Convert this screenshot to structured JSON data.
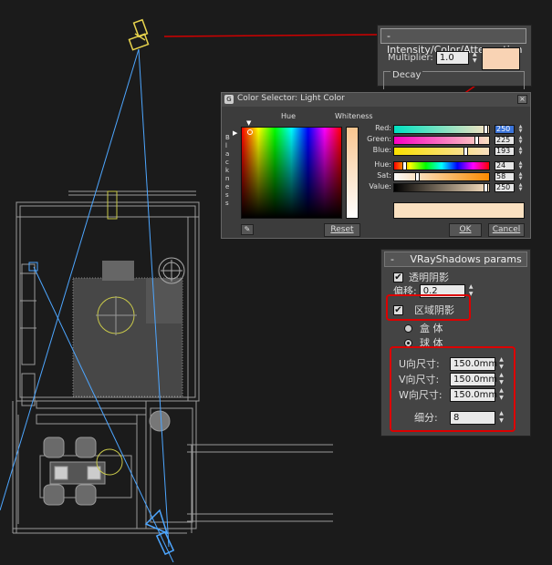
{
  "atten_panel": {
    "title": "Intensity/Color/Attenuation",
    "multiplier_label": "Multiplier:",
    "multiplier_value": "1.0",
    "swatch_color": "#f9d3b4",
    "decay_label": "Decay"
  },
  "color_selector": {
    "title": "Color Selector: Light Color",
    "hue_header": "Hue",
    "whiteness_header": "Whiteness",
    "blackness_label": "B l a c k n e s s",
    "channels": [
      {
        "label": "Red:",
        "value": "250",
        "level": 0.98
      },
      {
        "label": "Green:",
        "value": "225",
        "level": 0.88
      },
      {
        "label": "Blue:",
        "value": "193",
        "level": 0.76
      },
      {
        "label": "Hue:",
        "value": "24",
        "level": 0.09
      },
      {
        "label": "Sat:",
        "value": "58",
        "level": 0.23
      },
      {
        "label": "Value:",
        "value": "250",
        "level": 0.98
      }
    ],
    "preview_color": "#fae1c1",
    "reset_label": "Reset",
    "ok_label": "OK",
    "cancel_label": "Cancel"
  },
  "vray_shadows": {
    "title": "VRayShadows params",
    "transparent_shadows": "透明阴影",
    "transparent_checked": "✔",
    "bias_label": "偏移:",
    "bias_value": "0.2",
    "area_shadow": "区域阴影",
    "area_checked": "✔",
    "box_label": "盒 体",
    "sphere_label": "球 体",
    "u_size_label": "U向尺寸:",
    "u_size_value": "150.0mm",
    "v_size_label": "V向尺寸:",
    "v_size_value": "150.0mm",
    "w_size_label": "W向尺寸:",
    "w_size_value": "150.0mm",
    "subdivs_label": "细分:",
    "subdivs_value": "8"
  },
  "colors": {
    "annotation_red": "#d00000",
    "light_line_blue": "#4da6ff",
    "light_icon_yellow": "#e8d44d"
  }
}
